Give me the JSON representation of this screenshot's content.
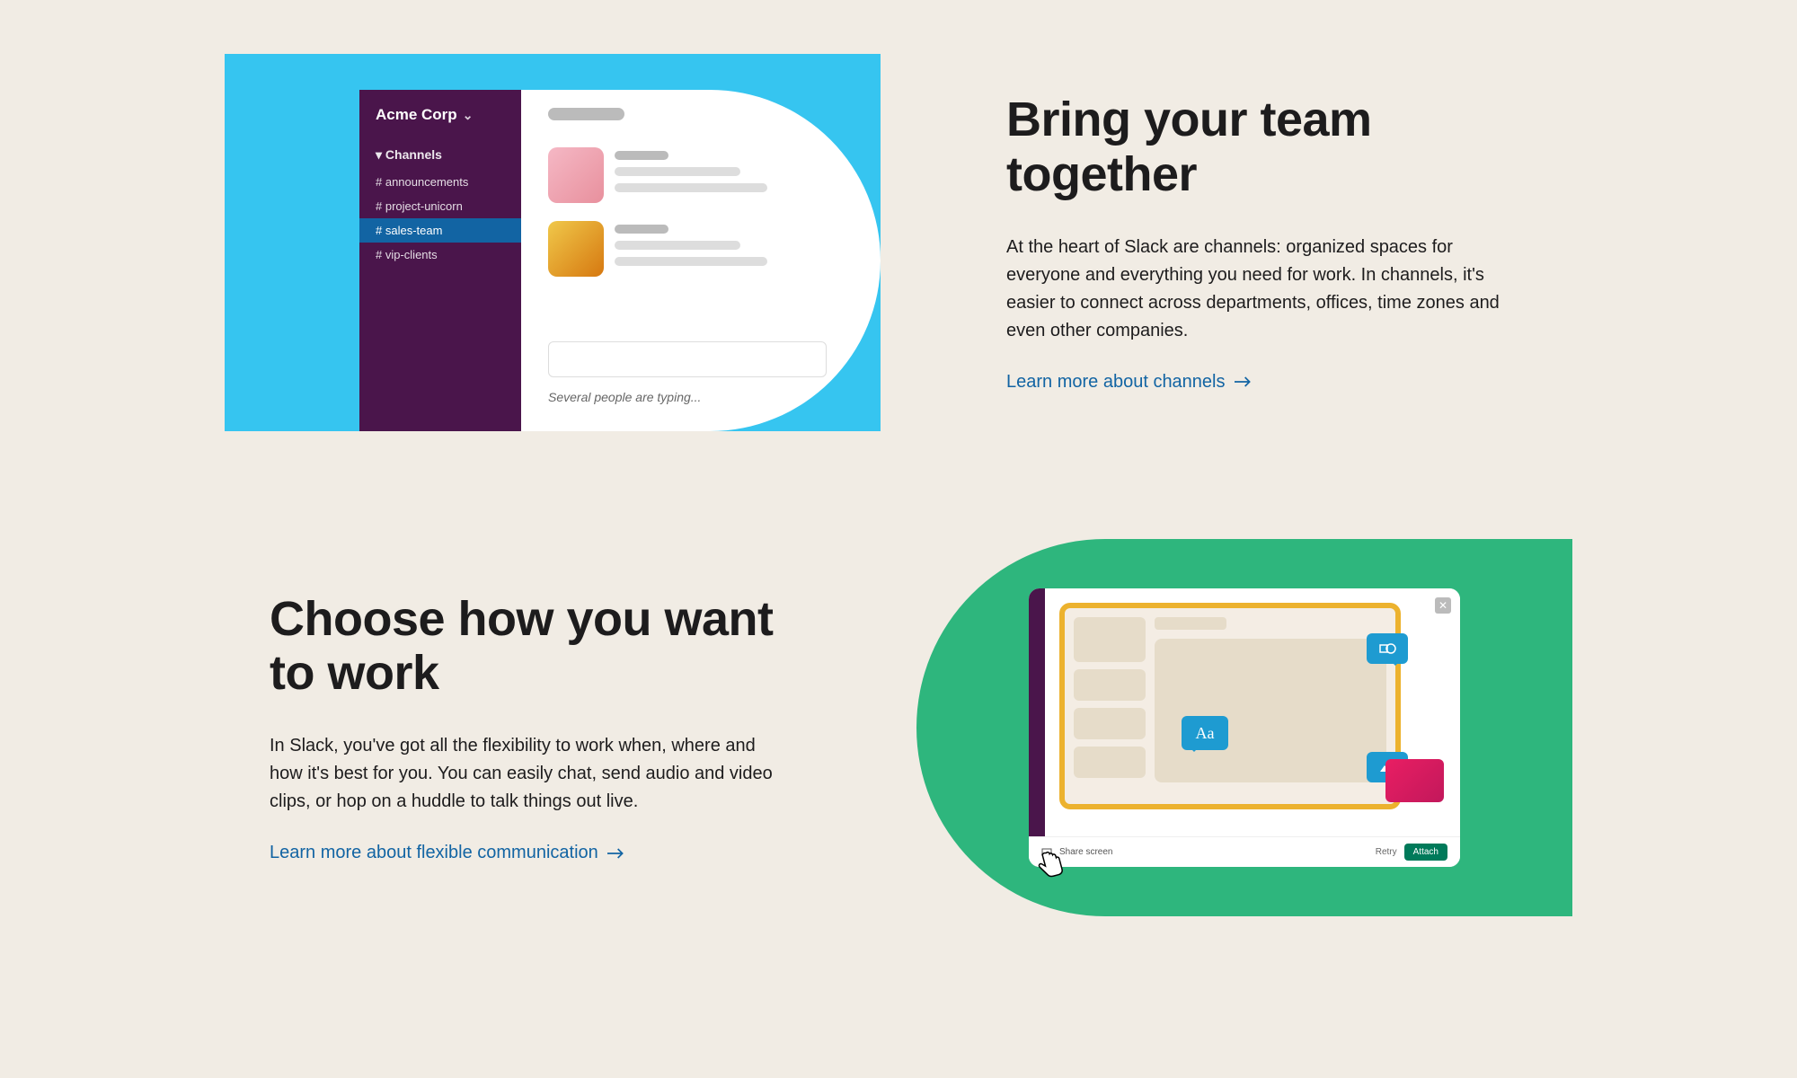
{
  "section1": {
    "heading": "Bring your team together",
    "body": "At the heart of Slack are channels: organized spaces for everyone and everything you need for work. In channels, it's easier to connect across departments, offices, time zones and even other companies.",
    "link": "Learn more about channels",
    "illustration": {
      "workspace": "Acme Corp",
      "channels_label": "Channels",
      "channels": [
        "# announcements",
        "# project-unicorn",
        "# sales-team",
        "# vip-clients"
      ],
      "typing": "Several people are typing..."
    }
  },
  "section2": {
    "heading": "Choose how you want to work",
    "body": "In Slack, you've got all the flexibility to work when, where and how it's best for you. You can easily chat, send audio and video clips, or hop on a huddle to talk things out live.",
    "link": "Learn more about flexible communication",
    "illustration": {
      "aa": "Aa",
      "share_screen": "Share screen",
      "retry": "Retry",
      "attach": "Attach"
    }
  }
}
